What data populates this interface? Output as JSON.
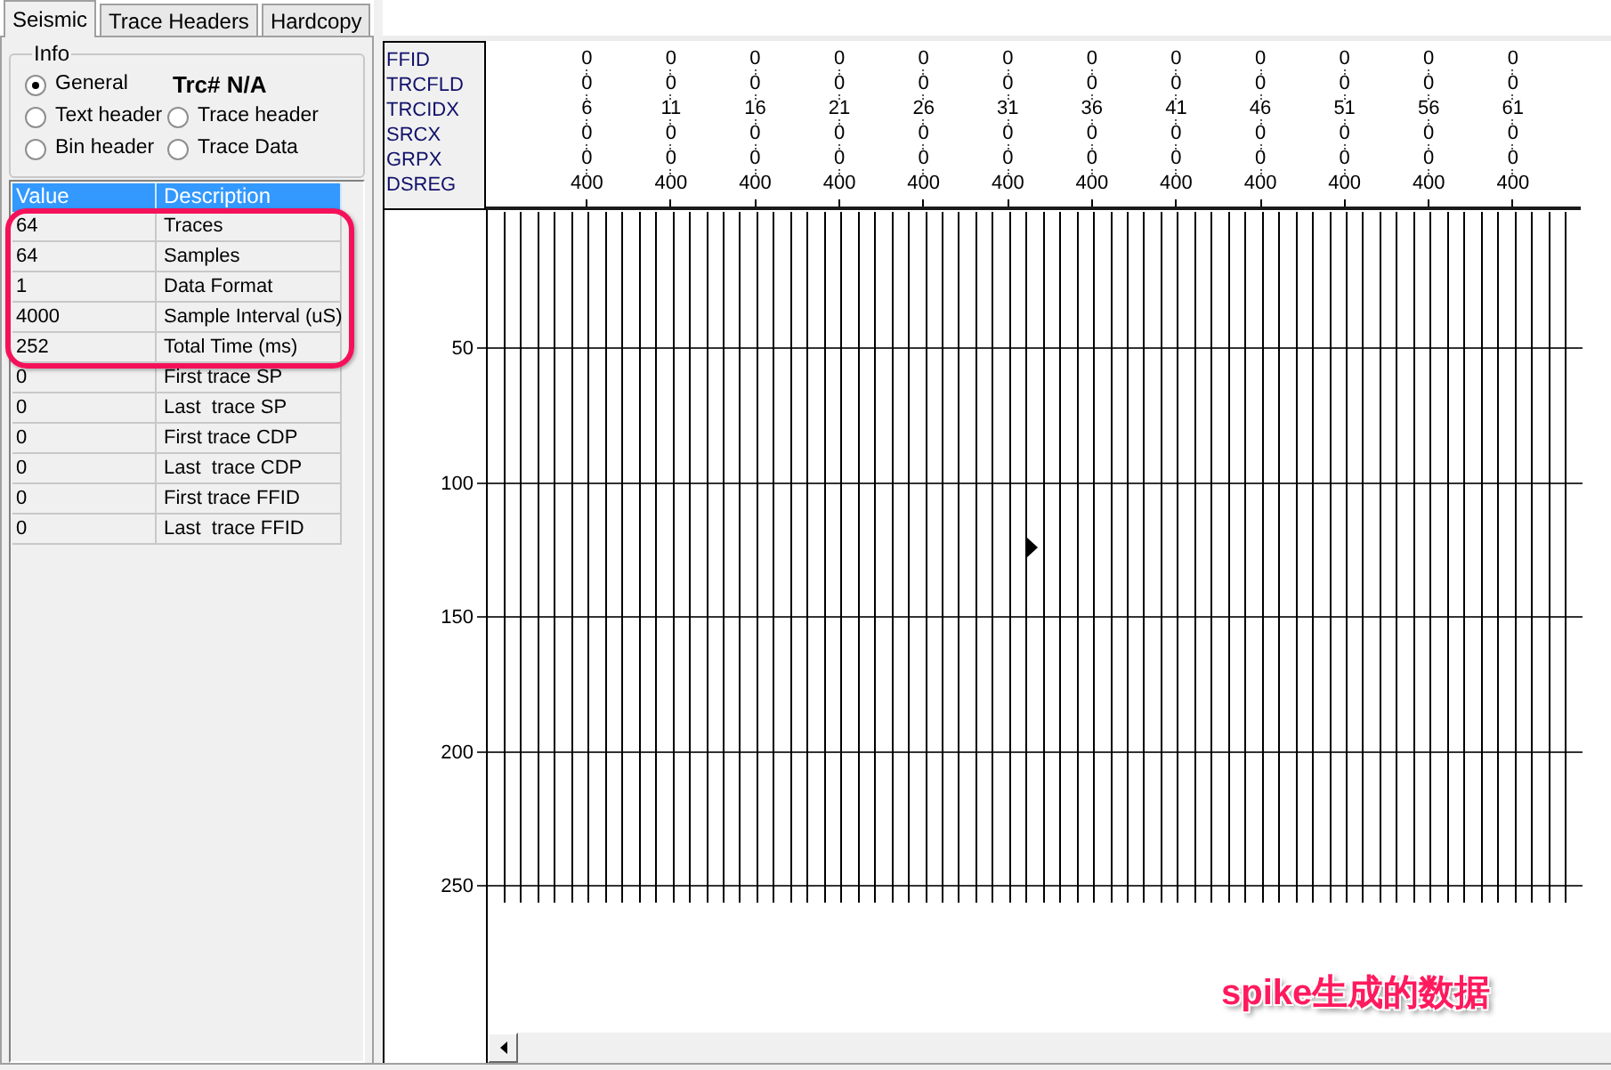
{
  "tabs": [
    {
      "label": "Seismic",
      "selected": true
    },
    {
      "label": "Trace Headers",
      "selected": false
    },
    {
      "label": "Hardcopy",
      "selected": false
    }
  ],
  "info": {
    "title": "Info",
    "rows": [
      {
        "items": [
          {
            "kind": "radio",
            "label": "General",
            "selected": true
          },
          {
            "kind": "label",
            "label": "Trc# N/A"
          }
        ]
      },
      {
        "items": [
          {
            "kind": "radio",
            "label": "Text header",
            "selected": false
          },
          {
            "kind": "radio",
            "label": "Trace header",
            "selected": false
          }
        ]
      },
      {
        "items": [
          {
            "kind": "radio",
            "label": "Bin header",
            "selected": false
          },
          {
            "kind": "radio",
            "label": "Trace Data",
            "selected": false
          }
        ]
      }
    ]
  },
  "table": {
    "columns": [
      "Value",
      "Description"
    ],
    "rows": [
      {
        "cells": [
          "64",
          "Traces"
        ],
        "circled": true
      },
      {
        "cells": [
          "64",
          "Samples"
        ],
        "circled": true
      },
      {
        "cells": [
          "1",
          "Data Format"
        ],
        "circled": true
      },
      {
        "cells": [
          "4000",
          "Sample Interval (uS)"
        ],
        "circled": true
      },
      {
        "cells": [
          "252",
          "Total Time (ms)"
        ],
        "circled": true
      },
      {
        "cells": [
          "0",
          "First trace SP"
        ],
        "circled": false
      },
      {
        "cells": [
          "0",
          "Last  trace SP"
        ],
        "circled": false
      },
      {
        "cells": [
          "0",
          "First trace CDP"
        ],
        "circled": false
      },
      {
        "cells": [
          "0",
          "Last  trace CDP"
        ],
        "circled": false
      },
      {
        "cells": [
          "0",
          "First trace FFID"
        ],
        "circled": false
      },
      {
        "cells": [
          "0",
          "Last  trace FFID"
        ],
        "circled": false
      }
    ]
  },
  "trace_headers": {
    "rows": [
      {
        "name": "FFID",
        "values": [
          "0",
          "0",
          "0",
          "0",
          "0",
          "0",
          "0",
          "0",
          "0",
          "0",
          "0",
          "0"
        ]
      },
      {
        "name": "TRCFLD",
        "values": [
          "0",
          "0",
          "0",
          "0",
          "0",
          "0",
          "0",
          "0",
          "0",
          "0",
          "0",
          "0"
        ]
      },
      {
        "name": "TRCIDX",
        "values": [
          "6",
          "11",
          "16",
          "21",
          "26",
          "31",
          "36",
          "41",
          "46",
          "51",
          "56",
          "61"
        ]
      },
      {
        "name": "SRCX",
        "values": [
          "0",
          "0",
          "0",
          "0",
          "0",
          "0",
          "0",
          "0",
          "0",
          "0",
          "0",
          "0"
        ]
      },
      {
        "name": "GRPX",
        "values": [
          "0",
          "0",
          "0",
          "0",
          "0",
          "0",
          "0",
          "0",
          "0",
          "0",
          "0",
          "0"
        ]
      },
      {
        "name": "DSREG",
        "values": [
          "400",
          "400",
          "400",
          "400",
          "400",
          "400",
          "400",
          "400",
          "400",
          "400",
          "400",
          "400"
        ]
      }
    ]
  },
  "section": {
    "time_labels": [
      "50",
      "100",
      "150",
      "200",
      "250"
    ]
  },
  "annotation": {
    "text": "spike生成的数据"
  }
}
